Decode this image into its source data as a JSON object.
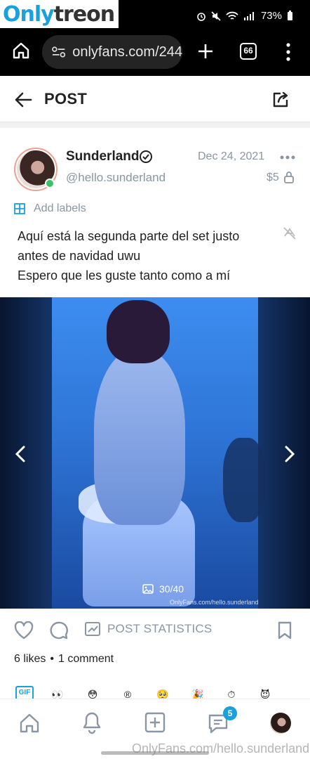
{
  "status_bar": {
    "battery": "73%",
    "icons": [
      "alarm-icon",
      "mute-icon",
      "wifi-icon",
      "volte-icon",
      "signal-icon",
      "battery-icon"
    ]
  },
  "watermark_top": {
    "part1": "Only",
    "part2": "treon"
  },
  "browser": {
    "url": "onlyfans.com/244",
    "tab_count": "66"
  },
  "header": {
    "title": "POST"
  },
  "post": {
    "author_name": "Sunderland",
    "handle": "@hello.sunderland",
    "date": "Dec 24, 2021",
    "price": "$5",
    "add_labels": "Add labels",
    "caption_lines": [
      "Aquí está la segunda parte del set justo",
      "antes de navidad uwu",
      "Espero que les guste tanto como a mí"
    ],
    "media_counter": "30/40",
    "media_watermark": "OnlyFans.com/hello.sunderland"
  },
  "actions": {
    "post_statistics": "POST STATISTICS",
    "likes": "6 likes",
    "separator": "•",
    "comments": "1 comment"
  },
  "emoji_row": [
    "👀",
    "😳",
    "®",
    "🥺",
    "🎉",
    "⏱",
    "😈"
  ],
  "bottom_nav": {
    "messages_badge": "5"
  },
  "watermark_bottom": "OnlyFans.com/hello.sunderland",
  "colors": {
    "accent": "#1aa0dc",
    "muted": "#8a96a3",
    "online": "#3cc06a"
  }
}
